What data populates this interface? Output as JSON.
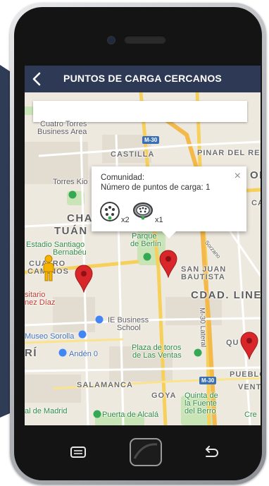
{
  "header": {
    "title": "PUNTOS DE CARGA CERCANOS",
    "back_icon": "chevron-left-icon"
  },
  "search": {
    "value": "",
    "placeholder": ""
  },
  "popup": {
    "line1": "Comunidad:",
    "line2": "Número de puntos de carga: 1",
    "close": "×",
    "connectors": [
      {
        "icon": "type2-connector-icon",
        "count": "x2"
      },
      {
        "icon": "ccs-connector-icon",
        "count": "x1"
      }
    ]
  },
  "map": {
    "labels": {
      "cuatro_torres": "Cuatro Torres",
      "business_area": "Business Area",
      "m30_top": "M-30",
      "castilla": "CASTILLA",
      "pinar": "PINAR DEL REY",
      "torres_kio": "Torres Kio",
      "cha": "CHA",
      "tuan": "TUÁN",
      "estadio": "Estadio Santiago",
      "bernabeu": "Bernabéu",
      "cuatro": "CUATRO",
      "caminos": "CAMINOS",
      "parque": "Parque",
      "de_berlin": "de Berlín",
      "san_juan": "SAN JUAN",
      "bautista": "BAUTISTA",
      "cdad_lineal": "CDAD. LINEAL",
      "m30_lateral": "M-30 Lateral",
      "sitario": "sitario",
      "nez_diaz": "nez Díaz",
      "ie_business": "IE Business",
      "school": "School",
      "museo_sorolla": "Museo Sorolla",
      "ri": "RÍ",
      "anden": "Andén 0",
      "plaza_toros": "Plaza de toros",
      "ventas": "de Las Ventas",
      "qu": "QU",
      "m30_bottom": "M-30",
      "pueblo": "PUEBLO",
      "vent": "VENT",
      "salamanca": "SALAMANCA",
      "goya": "GOYA",
      "quinta": "Quinta de",
      "la_fuente": "la Fuente",
      "del_berro": "del Berro",
      "al_madrid": "al de Madrid",
      "puerta_alcala": "Puerta de Alcalá",
      "cre": "Cre",
      "sorzano": "Sorzano",
      "or": "OR",
      "ca": "CA"
    }
  },
  "colors": {
    "appbar": "#2e3a55",
    "pin": "#d8262a",
    "road_yellow": "#f7cf5b",
    "park": "#c9e4b6"
  },
  "navbar": {
    "recents_icon": "recents-icon",
    "home_icon": "home-button-icon",
    "back_icon": "back-arrow-icon"
  }
}
